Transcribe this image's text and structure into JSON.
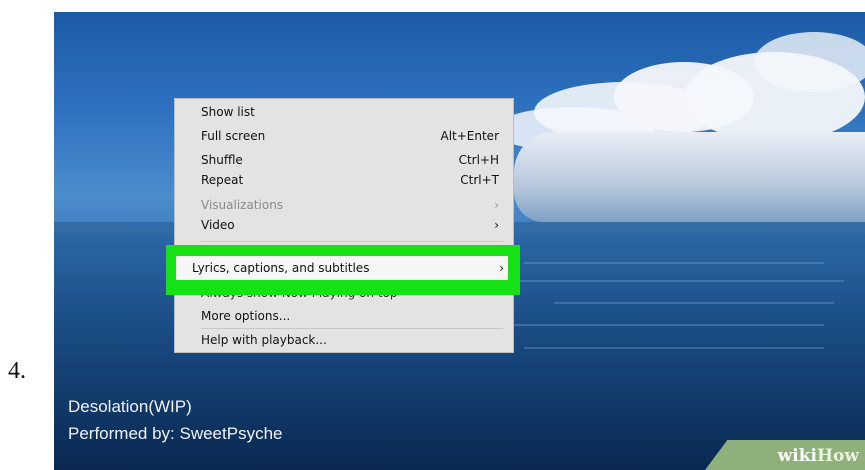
{
  "step_number": "4.",
  "menu": {
    "items": [
      {
        "label": "Show list",
        "shortcut": "",
        "disabled": false
      },
      {
        "label": "Full screen",
        "shortcut": "Alt+Enter",
        "disabled": false
      },
      {
        "label": "Shuffle",
        "shortcut": "Ctrl+H",
        "disabled": false
      },
      {
        "label": "Repeat",
        "shortcut": "Ctrl+T",
        "disabled": false
      },
      {
        "label": "Visualizations",
        "shortcut": "›",
        "disabled": true
      },
      {
        "label": "Video",
        "shortcut": "›",
        "disabled": false
      },
      {
        "label": "Always show Now Playing on top",
        "shortcut": "",
        "disabled": false
      },
      {
        "label": "More options...",
        "shortcut": "",
        "disabled": false
      },
      {
        "label": "Help with playback...",
        "shortcut": "",
        "disabled": false
      }
    ],
    "highlighted": {
      "label": "Lyrics, captions, and subtitles",
      "arrow": "›"
    }
  },
  "track": {
    "title": "Desolation(WIP)",
    "performer": "Performed by: SweetPsyche"
  },
  "watermark": {
    "wiki": "wiki",
    "how": "How"
  },
  "colors": {
    "highlight": "#16e016",
    "menu_bg": "#e3e3e3"
  }
}
